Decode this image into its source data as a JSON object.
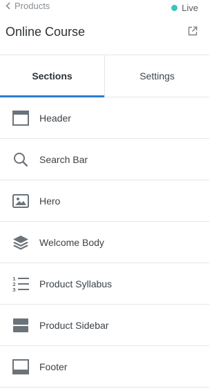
{
  "header": {
    "back_label": "Products",
    "live_label": "Live",
    "title": "Online Course"
  },
  "tabs": [
    {
      "label": "Sections",
      "active": true
    },
    {
      "label": "Settings",
      "active": false
    }
  ],
  "sections": [
    {
      "label": "Header",
      "icon": "layout-header-icon"
    },
    {
      "label": "Search Bar",
      "icon": "search-icon"
    },
    {
      "label": "Hero",
      "icon": "image-icon"
    },
    {
      "label": "Welcome Body",
      "icon": "layers-icon"
    },
    {
      "label": "Product Syllabus",
      "icon": "numbered-list-icon"
    },
    {
      "label": "Product Sidebar",
      "icon": "split-rows-icon"
    },
    {
      "label": "Footer",
      "icon": "layout-footer-icon"
    }
  ],
  "colors": {
    "accent": "#2b7bd0",
    "live": "#3cc4b8",
    "icon": "#6b7278"
  }
}
